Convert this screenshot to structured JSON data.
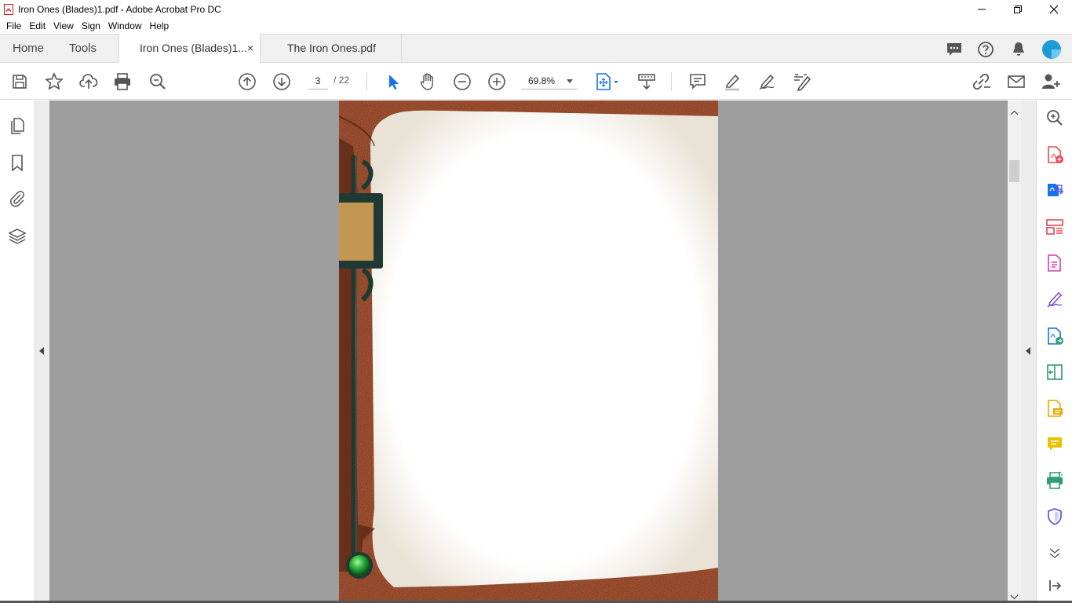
{
  "window": {
    "title": "Iron Ones (Blades)1.pdf - Adobe Acrobat Pro DC",
    "controls": [
      "minimize",
      "maximize",
      "close"
    ]
  },
  "menu": [
    "File",
    "Edit",
    "View",
    "Sign",
    "Window",
    "Help"
  ],
  "tabs": {
    "home": "Home",
    "tools": "Tools",
    "documents": [
      {
        "label": "Iron Ones (Blades)1...",
        "active": true,
        "close": "×"
      },
      {
        "label": "The Iron Ones.pdf",
        "active": false
      }
    ]
  },
  "toolbar": {
    "page_current": "3",
    "page_total": "/ 22",
    "zoom": "69.8%",
    "icons": [
      "save-icon",
      "bookmark-star-icon",
      "upload-cloud-icon",
      "print-icon",
      "find-zoom-icon",
      "page-up-icon",
      "page-down-icon",
      "select-cursor-icon",
      "hand-icon",
      "zoom-out-icon",
      "zoom-in-icon",
      "fit-page-icon",
      "scroll-mode-icon",
      "comment-icon",
      "highlight-icon",
      "sign-icon",
      "edit-pdf-icon",
      "share-link-icon",
      "email-icon",
      "add-user-icon"
    ]
  },
  "left_nav": [
    "page-thumbnails-icon",
    "bookmarks-icon",
    "attachments-icon",
    "layers-icon"
  ],
  "right_tools": [
    "search-zoom-icon",
    "create-pdf-icon",
    "export-pdf-icon",
    "organize-pages-icon",
    "edit-pdf-icon",
    "fill-sign-icon",
    "request-signature-icon",
    "compare-files-icon",
    "comment-tool-icon",
    "send-comments-icon",
    "print-production-icon",
    "protect-icon",
    "more-tools-chevron-icon",
    "collapse-pane-icon"
  ],
  "colors": {
    "accent": "#1473e6",
    "frame_rust": "#8a3a1e",
    "doc_background": "#9d9d9d",
    "avatar": "#1e9bd7"
  }
}
